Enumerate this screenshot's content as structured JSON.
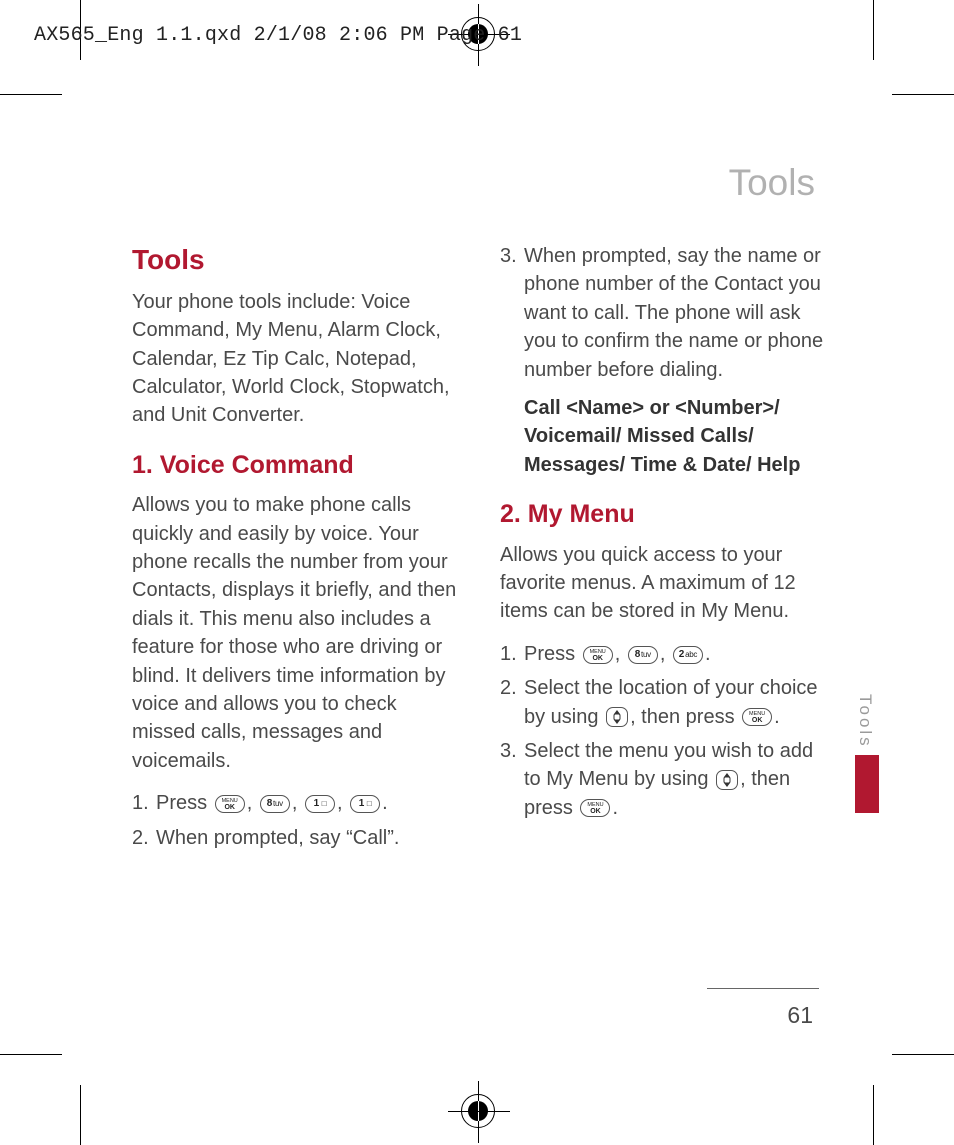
{
  "header": {
    "slug": "AX565_Eng 1.1.qxd  2/1/08  2:06 PM  Page 61"
  },
  "running_head": "Tools",
  "side_tab": "Tools",
  "page_number": "61",
  "left": {
    "title": "Tools",
    "intro": "Your phone tools include: Voice Command, My Menu, Alarm Clock, Calendar, Ez Tip Calc, Notepad, Calculator, World Clock, Stopwatch, and Unit Converter.",
    "section1_title": "1. Voice Command",
    "section1_body": "Allows you to make phone calls quickly and easily by voice. Your phone recalls the number from your Contacts, displays it briefly, and then dials it. This menu also includes a feature for those who are driving or blind. It delivers time information by voice and allows you to check missed calls, messages and voicemails.",
    "step1_num": "1.",
    "step1_prefix": "Press ",
    "step2_num": "2.",
    "step2_text": "When prompted, say “Call”."
  },
  "right": {
    "step3_num": "3.",
    "step3_text": "When prompted, say the name or phone number of the Contact you want to call. The phone will ask you to confirm the name or phone number before dialing.",
    "cmds": "Call <Name> or <Number>/ Voicemail/ Missed Calls/ Messages/ Time & Date/ Help",
    "section2_title": "2. My Menu",
    "section2_body": "Allows you quick access to your favorite menus. A maximum of 12 items can be stored in My Menu.",
    "s2_step1_num": "1.",
    "s2_step1_prefix": "Press ",
    "s2_step2_num": "2.",
    "s2_step2_a": "Select the location of your choice by using ",
    "s2_step2_b": ", then press ",
    "s2_step3_num": "3.",
    "s2_step3_a": "Select the menu you wish to add to My Menu by using ",
    "s2_step3_b": ", then press "
  },
  "keys": {
    "menu_ok": "MENU/OK",
    "k8": "8 tuv",
    "k1": "1",
    "k2": "2 abc",
    "nav": "navigation"
  }
}
